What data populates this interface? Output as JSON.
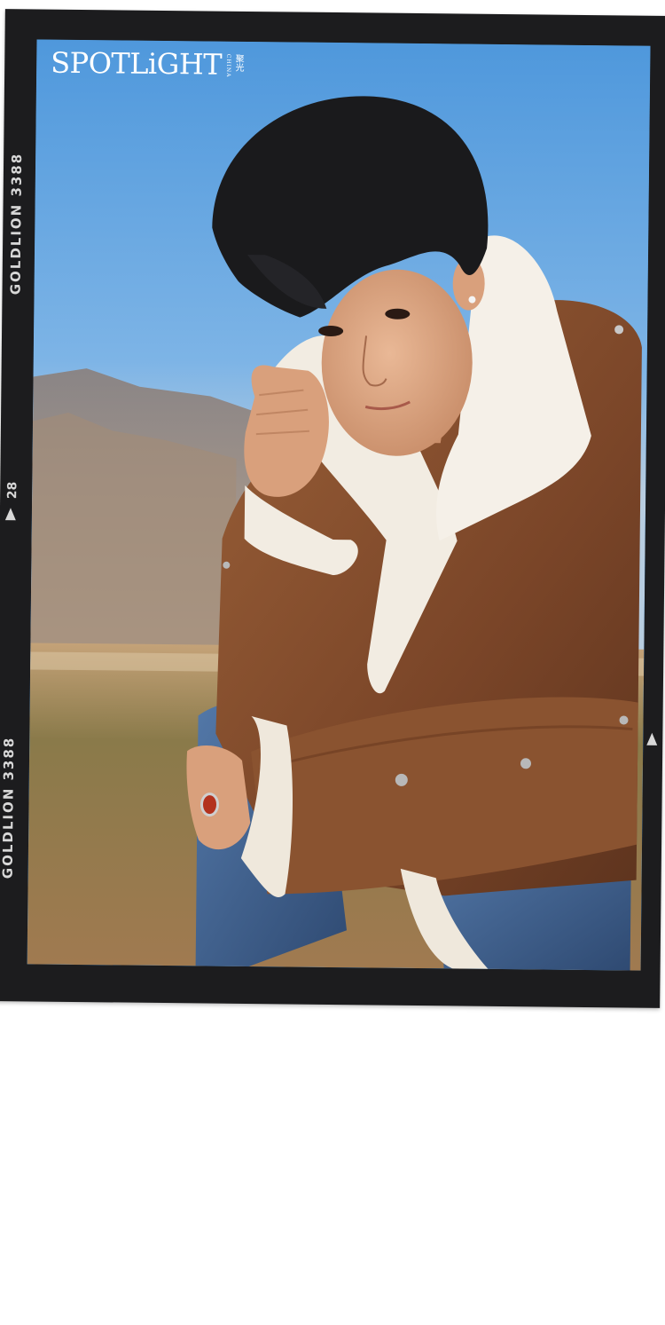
{
  "brand": {
    "name": "SPOTLiGHT",
    "china": "CHINA",
    "cn": "聚光"
  },
  "film": {
    "edge_label": "GOLDLION 3388",
    "edge_label_2": "GOLDLION 3388",
    "frame_number": "28"
  },
  "colors": {
    "frame": "#1c1c1e",
    "sky": "#5aa0de",
    "jacket": "#8a5330",
    "shearling": "#f2ece2",
    "denim": "#3e5e8a",
    "hair": "#1a1a1c",
    "grass": "#a07a4c"
  },
  "scene": {
    "subject": "young man in brown suede jacket with white shearling collar and blue jeans, crouching outdoors"
  }
}
